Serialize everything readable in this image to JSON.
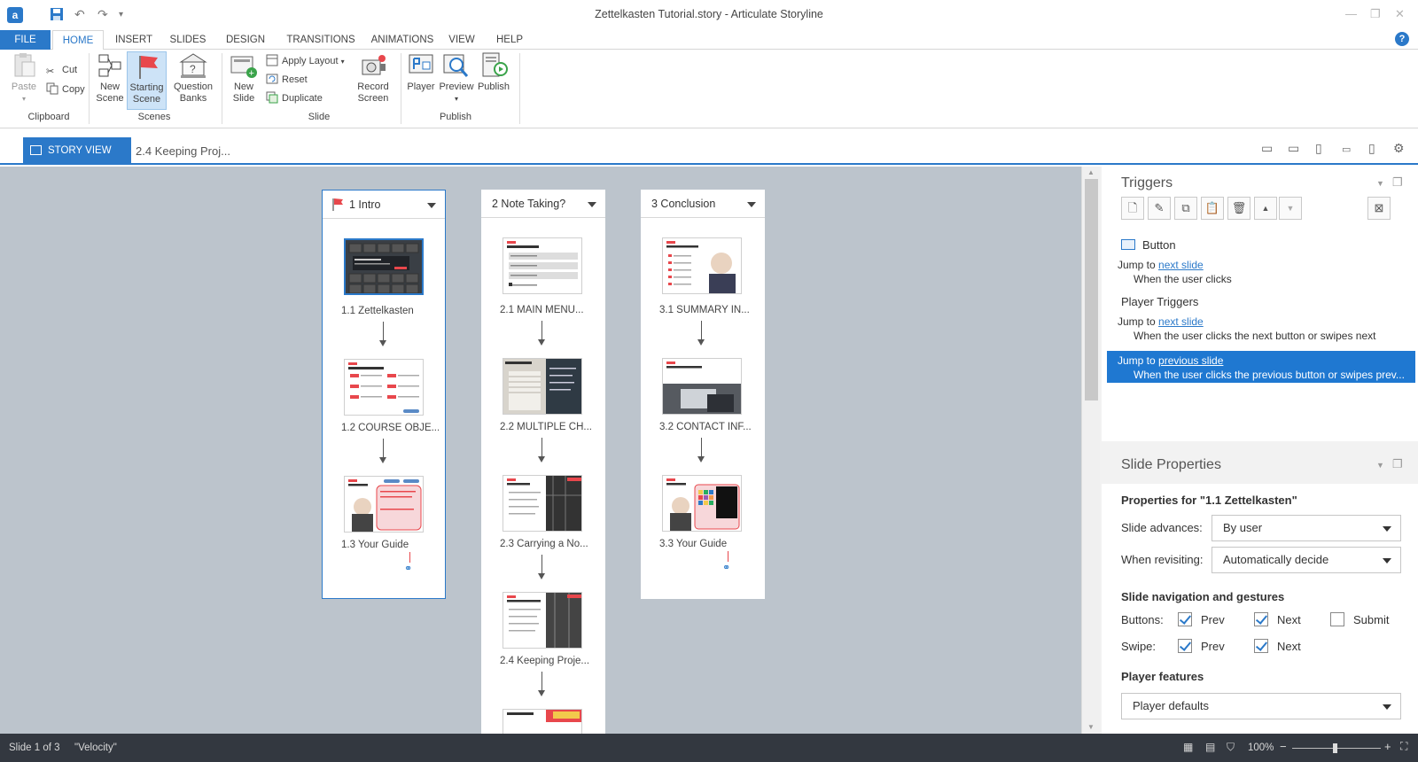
{
  "window": {
    "title": "Zettelkasten Tutorial.story -  Articulate Storyline"
  },
  "tabs": [
    "FILE",
    "HOME",
    "INSERT",
    "SLIDES",
    "DESIGN",
    "TRANSITIONS",
    "ANIMATIONS",
    "VIEW",
    "HELP"
  ],
  "ribbon": {
    "clipboard": {
      "paste": "Paste",
      "cut": "Cut",
      "copy": "Copy",
      "group": "Clipboard"
    },
    "scenes": {
      "new_scene": "New\nScene",
      "starting_scene": "Starting\nScene",
      "question_banks": "Question\nBanks",
      "group": "Scenes"
    },
    "slide": {
      "new_slide": "New\nSlide",
      "apply_layout": "Apply Layout",
      "reset": "Reset",
      "duplicate": "Duplicate",
      "record_screen": "Record\nScreen",
      "group": "Slide"
    },
    "publish": {
      "player": "Player",
      "preview": "Preview",
      "publish": "Publish",
      "group": "Publish"
    }
  },
  "storybar": {
    "story_view": "STORY VIEW",
    "breadcrumb": "2.4 Keeping Proj..."
  },
  "scenes": [
    {
      "title": "1 Intro",
      "slides": [
        "1.1 Zettelkasten",
        "1.2 COURSE OBJE...",
        "1.3 Your Guide"
      ]
    },
    {
      "title": "2 Note Taking?",
      "slides": [
        "2.1 MAIN MENU...",
        "2.2 MULTIPLE CH...",
        "2.3 Carrying a No...",
        "2.4 Keeping Proje..."
      ]
    },
    {
      "title": "3 Conclusion",
      "slides": [
        "3.1 SUMMARY IN...",
        "3.2 CONTACT INF...",
        "3.3 Your Guide"
      ]
    }
  ],
  "triggers": {
    "title": "Triggers",
    "object": "Button",
    "t1_action": "Jump to",
    "t1_target": "next slide",
    "t1_when": "When the user clicks",
    "player_title": "Player Triggers",
    "t2_action": "Jump to",
    "t2_target": "next slide",
    "t2_when": "When the user clicks the next button or swipes next",
    "t3_action": "Jump to",
    "t3_target": "previous slide",
    "t3_when": "When the user clicks the previous button or swipes prev..."
  },
  "slide_properties": {
    "title": "Slide Properties",
    "props_for": "Properties for \"1.1 Zettelkasten\"",
    "advances_label": "Slide advances:",
    "advances_value": "By user",
    "revisit_label": "When revisiting:",
    "revisit_value": "Automatically decide",
    "nav_title": "Slide navigation and gestures",
    "buttons_label": "Buttons:",
    "swipe_label": "Swipe:",
    "prev": "Prev",
    "next": "Next",
    "submit": "Submit",
    "buttons_prev_checked": true,
    "buttons_next_checked": true,
    "buttons_submit_checked": false,
    "swipe_prev_checked": true,
    "swipe_next_checked": true,
    "player_features_title": "Player features",
    "player_features_value": "Player defaults"
  },
  "status": {
    "slide": "Slide 1 of 3",
    "theme": "\"Velocity\"",
    "zoom": "100%"
  },
  "colors": {
    "accent": "#2b79c9",
    "selection": "#1f78d1",
    "canvas": "#bcc4cc",
    "statusbar": "#333840"
  }
}
